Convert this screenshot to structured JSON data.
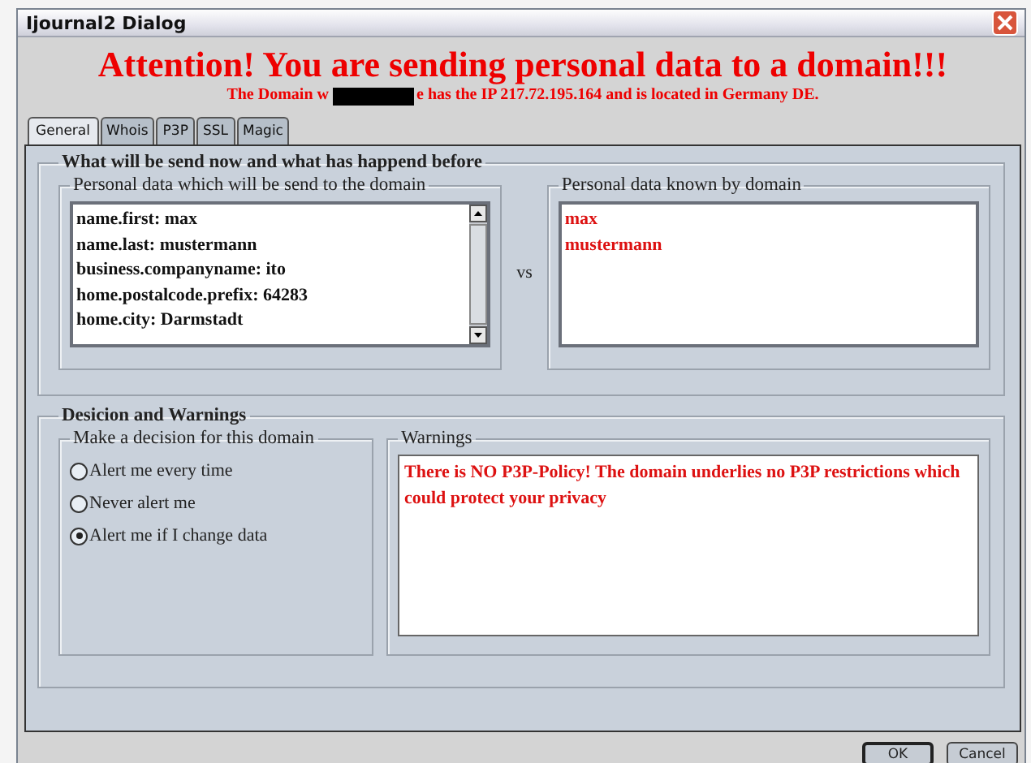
{
  "window": {
    "title": "Ijournal2 Dialog"
  },
  "headline": "Attention! You are sending personal data to a domain!!!",
  "subtitle": {
    "before": "The Domain w",
    "after": "e has the IP 217.72.195.164 and is located in Germany DE."
  },
  "tabs": [
    {
      "label": "General",
      "selected": true
    },
    {
      "label": "Whois",
      "selected": false
    },
    {
      "label": "P3P",
      "selected": false
    },
    {
      "label": "SSL",
      "selected": false
    },
    {
      "label": "Magic",
      "selected": false
    }
  ],
  "data_section": {
    "title": "What will be send now and what has happend before",
    "sent": {
      "title": "Personal data which will be send to the domain",
      "items": [
        "name.first: max",
        "name.last: mustermann",
        "business.companyname: ito",
        "home.postalcode.prefix: 64283",
        "home.city: Darmstadt"
      ]
    },
    "separator": "vs",
    "known": {
      "title": "Personal data known by domain",
      "items": [
        "max",
        "mustermann"
      ]
    }
  },
  "decision_section": {
    "title": "Desicion and Warnings",
    "decision": {
      "title": "Make a decision for this domain",
      "options": [
        {
          "label": "Alert me every time",
          "selected": false
        },
        {
          "label": "Never alert me",
          "selected": false
        },
        {
          "label": "Alert me if I change data",
          "selected": true
        }
      ]
    },
    "warnings": {
      "title": "Warnings",
      "text": "There is NO P3P-Policy! The domain underlies no P3P restrictions which could protect your privacy"
    }
  },
  "buttons": [
    {
      "label": "OK",
      "default": true
    },
    {
      "label": "Cancel",
      "default": false
    }
  ]
}
